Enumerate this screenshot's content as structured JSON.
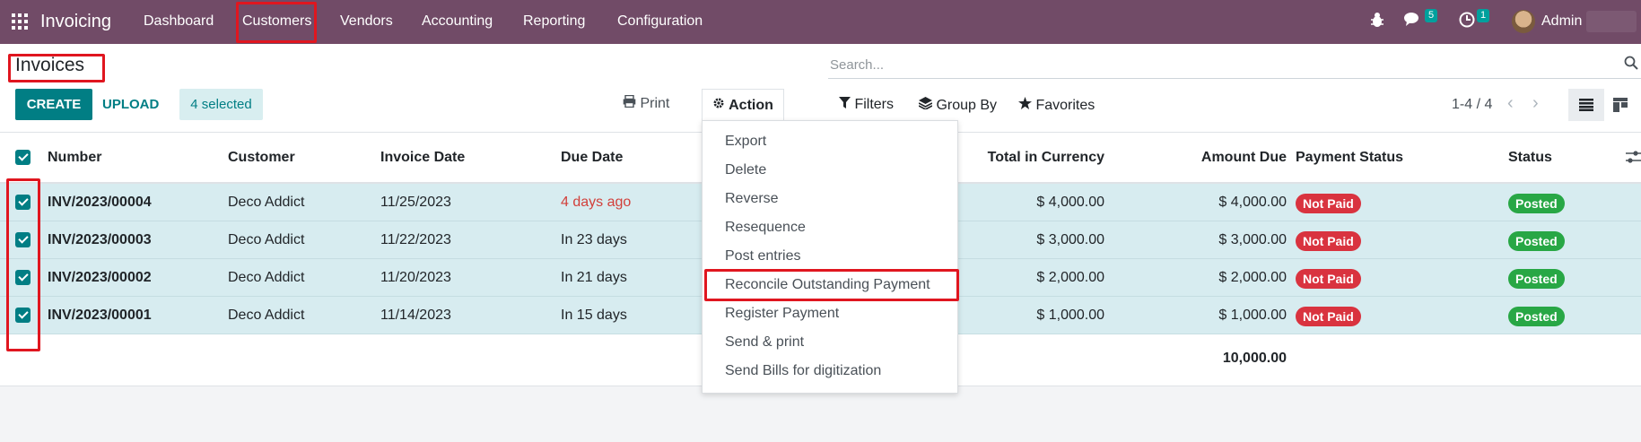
{
  "navbar": {
    "app_name": "Invoicing",
    "menu": [
      "Dashboard",
      "Customers",
      "Vendors",
      "Accounting",
      "Reporting",
      "Configuration"
    ],
    "messages_count": "5",
    "activities_count": "1",
    "user_name": "Admin"
  },
  "page": {
    "title": "Invoices",
    "create_label": "CREATE",
    "upload_label": "UPLOAD",
    "selected_label": "4 selected",
    "print_label": "Print",
    "action_label": "Action",
    "search_placeholder": "Search...",
    "filters_label": "Filters",
    "groupby_label": "Group By",
    "favorites_label": "Favorites",
    "pager": "1-4 / 4"
  },
  "table": {
    "headers": {
      "number": "Number",
      "customer": "Customer",
      "invoice_date": "Invoice Date",
      "due_date": "Due Date",
      "total_currency": "Total in Currency",
      "amount_due": "Amount Due",
      "payment_status": "Payment Status",
      "status": "Status"
    },
    "rows": [
      {
        "number": "INV/2023/00004",
        "customer": "Deco Addict",
        "invoice_date": "11/25/2023",
        "due_date": "4 days ago",
        "total": "$ 4,000.00",
        "amount_due": "$ 4,000.00",
        "payment_status": "Not Paid",
        "status": "Posted"
      },
      {
        "number": "INV/2023/00003",
        "customer": "Deco Addict",
        "invoice_date": "11/22/2023",
        "due_date": "In 23 days",
        "total": "$ 3,000.00",
        "amount_due": "$ 3,000.00",
        "payment_status": "Not Paid",
        "status": "Posted"
      },
      {
        "number": "INV/2023/00002",
        "customer": "Deco Addict",
        "invoice_date": "11/20/2023",
        "due_date": "In 21 days",
        "total": "$ 2,000.00",
        "amount_due": "$ 2,000.00",
        "payment_status": "Not Paid",
        "status": "Posted"
      },
      {
        "number": "INV/2023/00001",
        "customer": "Deco Addict",
        "invoice_date": "11/14/2023",
        "due_date": "In 15 days",
        "total": "$ 1,000.00",
        "amount_due": "$ 1,000.00",
        "payment_status": "Not Paid",
        "status": "Posted"
      }
    ],
    "amount_due_total": "10,000.00"
  },
  "action_menu": [
    "Export",
    "Delete",
    "Reverse",
    "Resequence",
    "Post entries",
    "Reconcile Outstanding Payment",
    "Register Payment",
    "Send & print",
    "Send Bills for digitization"
  ],
  "colors": {
    "navbar": "#714b67",
    "primary": "#017e84",
    "selected_row": "#d7ecf0",
    "not_paid": "#d9333f",
    "posted": "#28a745",
    "annotation": "#e0161f"
  }
}
